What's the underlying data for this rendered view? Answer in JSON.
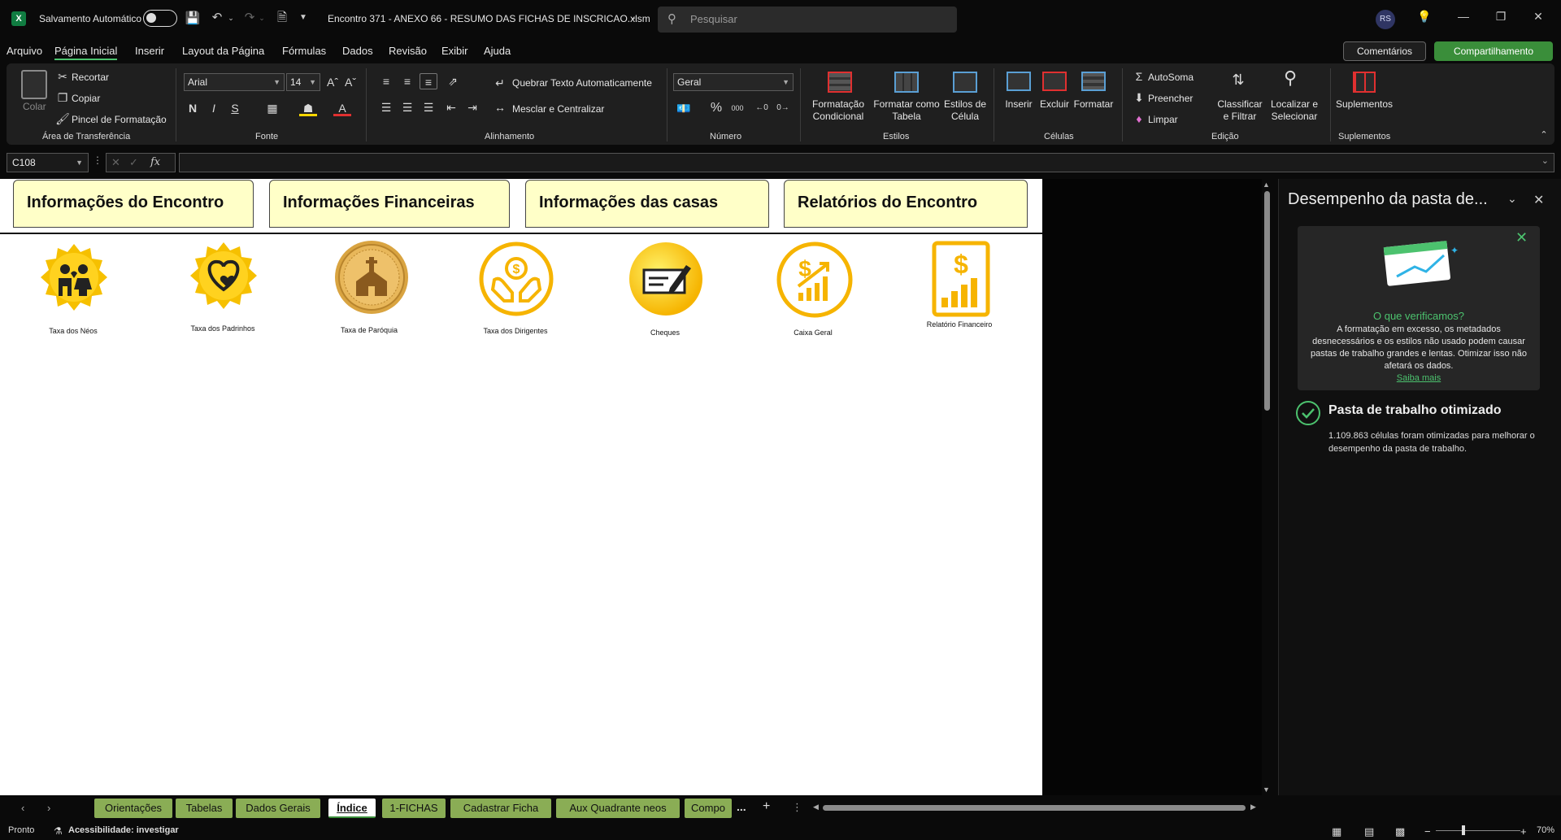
{
  "titlebar": {
    "autosave_label": "Salvamento Automático",
    "filename": "Encontro 371 - ANEXO 66 - RESUMO DAS FICHAS DE INSCRICAO.xlsm",
    "search_placeholder": "Pesquisar",
    "user_initials": "RS",
    "app_icon_letter": "X"
  },
  "menu": {
    "items": [
      "Arquivo",
      "Página Inicial",
      "Inserir",
      "Layout da Página",
      "Fórmulas",
      "Dados",
      "Revisão",
      "Exibir",
      "Ajuda"
    ],
    "active": "Página Inicial",
    "comments": "Comentários",
    "share": "Compartilhamento"
  },
  "ribbon": {
    "clipboard": {
      "paste": "Colar",
      "cut": "Recortar",
      "copy": "Copiar",
      "format_painter": "Pincel de Formatação",
      "label": "Área de Transferência"
    },
    "font": {
      "family": "Arial",
      "size": "14",
      "bold": "N",
      "italic": "I",
      "underline": "S",
      "label": "Fonte"
    },
    "alignment": {
      "wrap": "Quebrar Texto Automaticamente",
      "merge": "Mesclar e Centralizar",
      "label": "Alinhamento"
    },
    "number": {
      "format": "Geral",
      "percent": "%",
      "thousands": "000",
      "label": "Número"
    },
    "styles": {
      "conditional": [
        "Formatação",
        "Condicional"
      ],
      "table": [
        "Formatar como",
        "Tabela"
      ],
      "cell": [
        "Estilos de",
        "Célula"
      ],
      "label": "Estilos"
    },
    "cells": {
      "insert": "Inserir",
      "delete": "Excluir",
      "format": "Formatar",
      "label": "Células"
    },
    "editing": {
      "autosum": "AutoSoma",
      "fill": "Preencher",
      "clear": "Limpar",
      "sort": [
        "Classificar",
        "e Filtrar"
      ],
      "find": [
        "Localizar e",
        "Selecionar"
      ],
      "label": "Edição"
    },
    "addins": {
      "button": "Suplementos",
      "label": "Suplementos"
    }
  },
  "formula_bar": {
    "name_box": "C108",
    "fx": "fx",
    "formula": ""
  },
  "sheet": {
    "header_tabs": [
      "Informações do Encontro",
      "Informações Financeiras",
      "Informações das casas",
      "Relatórios do Encontro"
    ],
    "icons": [
      {
        "caption": "Taxa dos Néos",
        "icon": "family-icon"
      },
      {
        "caption": "Taxa dos Padrinhos",
        "icon": "heart-hands-icon"
      },
      {
        "caption": "Taxa de Paróquia",
        "icon": "church-icon"
      },
      {
        "caption": "Taxa dos Dirigentes",
        "icon": "money-hands-icon"
      },
      {
        "caption": "Cheques",
        "icon": "check-icon"
      },
      {
        "caption": "Caixa Geral",
        "icon": "dollar-growth-icon"
      },
      {
        "caption": "Relatório Financeiro",
        "icon": "financial-report-icon"
      }
    ],
    "accent_color": "#f6c000"
  },
  "side_pane": {
    "title": "Desempenho da pasta de...",
    "card_heading": "O que verificamos?",
    "card_text": "A formatação em excesso, os metadados desnecessários e os estilos não usado podem causar pastas de trabalho grandes e lentas. Otimizar isso não afetará os dados.",
    "card_link": "Saiba mais",
    "result_title": "Pasta de trabalho otimizado",
    "result_text": "1.109.863 células foram otimizadas para melhorar o desempenho da pasta de trabalho."
  },
  "sheet_tabs": {
    "items": [
      "Orientações",
      "Tabelas",
      "Dados Gerais",
      "Índice",
      "1-FICHAS",
      "Cadastrar Ficha",
      "Aux Quadrante neos",
      "Compo"
    ],
    "active": "Índice",
    "more": "..."
  },
  "status_bar": {
    "ready": "Pronto",
    "accessibility": "Acessibilidade: investigar",
    "zoom": "70%",
    "zoom_level": 0.7
  }
}
